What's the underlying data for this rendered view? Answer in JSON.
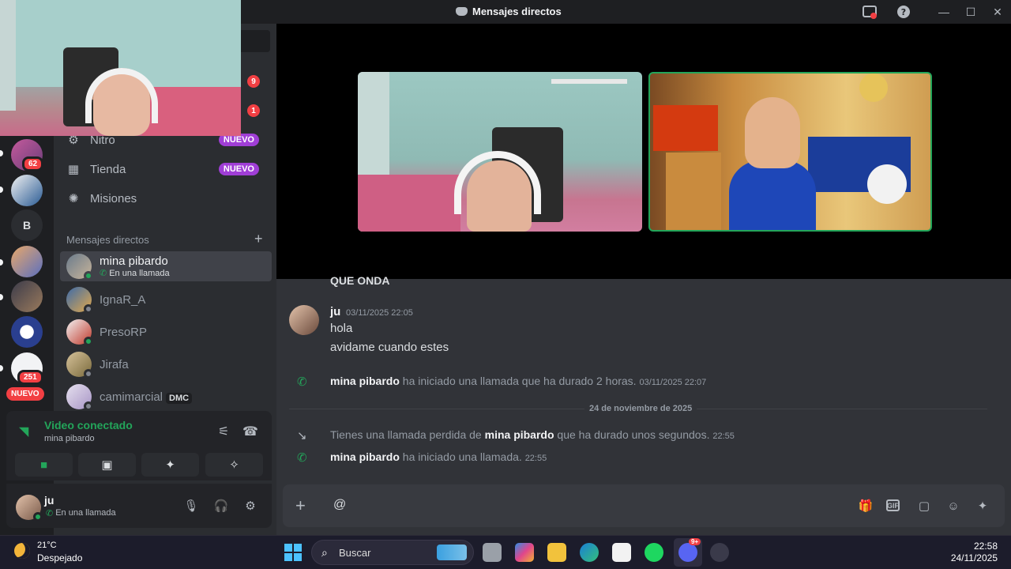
{
  "window": {
    "title": "Mensajes directos"
  },
  "sidebar": {
    "badges": [
      "9",
      "1"
    ],
    "nav": [
      {
        "label": "Nitro",
        "badge": "NUEVO",
        "icon": "nitro-icon"
      },
      {
        "label": "Tienda",
        "badge": "NUEVO",
        "icon": "shop-icon"
      },
      {
        "label": "Misiones",
        "badge": "",
        "icon": "quests-icon"
      }
    ],
    "dm_header": "Mensajes directos",
    "dms": [
      {
        "name": "mina pibardo",
        "sub": "En una llamada",
        "status": "online",
        "active": true
      },
      {
        "name": "IgnaR_A",
        "sub": "",
        "status": "offline",
        "active": false
      },
      {
        "name": "PresoRP",
        "sub": "",
        "status": "online",
        "active": false
      },
      {
        "name": "Jirafa",
        "sub": "",
        "status": "offline",
        "active": false
      },
      {
        "name": "camimarcial",
        "sub": "",
        "tag": "DMC",
        "status": "offline",
        "active": false
      }
    ]
  },
  "rail": {
    "badges": [
      "62",
      "251"
    ],
    "letter_server": "B",
    "nuevo": "NUEVO"
  },
  "voice": {
    "status": "Video conectado",
    "channel": "mina pibardo"
  },
  "user": {
    "name": "ju",
    "status": "En una llamada"
  },
  "chat": {
    "cut_top": "QUE ONDA",
    "message": {
      "author": "ju",
      "time": "03/11/2025 22:05",
      "lines": [
        "hola",
        "avidame cuando estes"
      ]
    },
    "sys1": {
      "who": "mina pibardo",
      "text": " ha iniciado una llamada que ha durado 2 horas.",
      "time": "03/11/2025 22:07"
    },
    "divider": "24 de noviembre de 2025",
    "sys2": {
      "pre": "Tienes una llamada perdida de ",
      "who": "mina pibardo",
      "text": " que ha durado unos segundos.",
      "time": "22:55"
    },
    "sys3": {
      "who": "mina pibardo",
      "text": " ha iniciado una llamada.",
      "time": "22:55"
    },
    "composer_text": "@"
  },
  "taskbar": {
    "temp": "21°C",
    "condition": "Despejado",
    "search": "Buscar",
    "discord_badge": "9+",
    "time": "22:58",
    "date": "24/11/2025"
  },
  "colors": {
    "accent_green": "#23a55a",
    "nuevo_purple": "#a03ed6",
    "alert_red": "#f23f43"
  }
}
